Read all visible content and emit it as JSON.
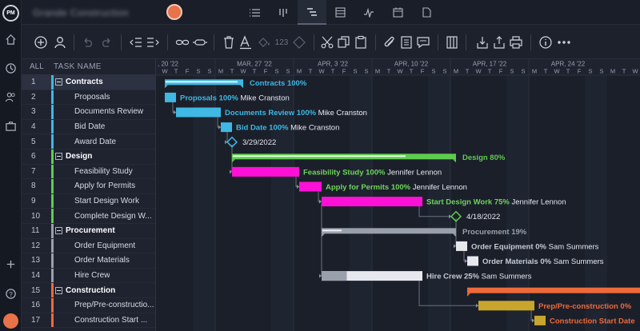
{
  "app": {
    "logo": "PM",
    "project_title": "Grande Construction"
  },
  "rail_icons": [
    "home-icon",
    "clock-icon",
    "people-icon",
    "briefcase-icon",
    "plus-icon",
    "help-icon"
  ],
  "view_tabs": [
    "list-view-icon",
    "board-view-icon",
    "gantt-view-icon",
    "sheet-view-icon",
    "dashboard-view-icon",
    "calendar-view-icon",
    "files-view-icon"
  ],
  "toolbar": {
    "number_format_label": "123"
  },
  "grid": {
    "col_all": "ALL",
    "col_task_name": "TASK NAME",
    "rows": [
      {
        "num": "1",
        "name": "Contracts",
        "group": true,
        "selected": true,
        "color": "#3fb8e3"
      },
      {
        "num": "2",
        "name": "Proposals",
        "color": "#3fb8e3"
      },
      {
        "num": "3",
        "name": "Documents Review",
        "color": "#3fb8e3"
      },
      {
        "num": "4",
        "name": "Bid Date",
        "color": "#3fb8e3"
      },
      {
        "num": "5",
        "name": "Award Date",
        "color": "#3fb8e3"
      },
      {
        "num": "6",
        "name": "Design",
        "group": true,
        "color": "#5ecb4f"
      },
      {
        "num": "7",
        "name": "Feasibility Study",
        "color": "#5ecb4f"
      },
      {
        "num": "8",
        "name": "Apply for Permits",
        "color": "#5ecb4f"
      },
      {
        "num": "9",
        "name": "Start Design Work",
        "color": "#5ecb4f"
      },
      {
        "num": "10",
        "name": "Complete Design W...",
        "color": "#5ecb4f"
      },
      {
        "num": "11",
        "name": "Procurement",
        "group": true,
        "color": "#9aa0ab"
      },
      {
        "num": "12",
        "name": "Order Equipment",
        "color": "#9aa0ab"
      },
      {
        "num": "13",
        "name": "Order Materials",
        "color": "#9aa0ab"
      },
      {
        "num": "14",
        "name": "Hire Crew",
        "color": "#9aa0ab"
      },
      {
        "num": "15",
        "name": "Construction",
        "group": true,
        "color": "#ee6a3a"
      },
      {
        "num": "16",
        "name": "Prep/Pre-constructio...",
        "color": "#ee6a3a"
      },
      {
        "num": "17",
        "name": "Construction Start ...",
        "color": "#ee6a3a"
      }
    ]
  },
  "timeline": {
    "weeks": [
      ", 20 '22",
      "MAR, 27 '22",
      "APR, 3 '22",
      "APR, 10 '22",
      "APR, 17 '22",
      "APR, 24 '22"
    ],
    "day_letters": [
      "W",
      "T",
      "F",
      "S",
      "S",
      "M",
      "T",
      "W",
      "T",
      "F",
      "S",
      "S",
      "M",
      "T",
      "W",
      "T",
      "F",
      "S",
      "S",
      "M",
      "T",
      "W",
      "T",
      "F",
      "S",
      "S",
      "M",
      "T",
      "W",
      "T",
      "F",
      "S",
      "S",
      "M",
      "T",
      "W",
      "T",
      "F",
      "S",
      "S",
      "M",
      "T",
      "W"
    ]
  },
  "bars": [
    {
      "row": 0,
      "kind": "group",
      "start": 0.5,
      "end": 7.5,
      "progress": 1.0,
      "color": "#3fb8e3",
      "label": "Contracts",
      "percent": "100%",
      "assignee": ""
    },
    {
      "row": 1,
      "kind": "task",
      "start": 0.5,
      "end": 1.5,
      "progress": 1.0,
      "color": "#3fb8e3",
      "label": "Proposals",
      "percent": "100%",
      "assignee": "Mike Cranston"
    },
    {
      "row": 2,
      "kind": "task",
      "start": 1.5,
      "end": 5.5,
      "progress": 1.0,
      "color": "#3fb8e3",
      "label": "Documents Review",
      "percent": "100%",
      "assignee": "Mike Cranston"
    },
    {
      "row": 3,
      "kind": "task",
      "start": 5.5,
      "end": 6.5,
      "progress": 1.0,
      "color": "#3fb8e3",
      "label": "Bid Date",
      "percent": "100%",
      "assignee": "Mike Cranston"
    },
    {
      "row": 4,
      "kind": "milestone",
      "start": 6.5,
      "color": "#3fb8e3",
      "date": "3/29/2022"
    },
    {
      "row": 5,
      "kind": "group",
      "start": 6.5,
      "end": 26.5,
      "progress": 0.8,
      "color": "#5ecb4f",
      "label": "Design",
      "percent": "80%",
      "assignee": ""
    },
    {
      "row": 6,
      "kind": "task",
      "start": 6.5,
      "end": 12.5,
      "progress": 1.0,
      "color": "#ff10d6",
      "label": "Feasibility Study",
      "percent": "100%",
      "assignee": "Jennifer Lennon",
      "label_color": "#6fd55c"
    },
    {
      "row": 7,
      "kind": "task",
      "start": 12.5,
      "end": 14.5,
      "progress": 1.0,
      "color": "#ff10d6",
      "label": "Apply for Permits",
      "percent": "100%",
      "assignee": "Jennifer Lennon",
      "label_color": "#6fd55c"
    },
    {
      "row": 8,
      "kind": "task",
      "start": 14.5,
      "end": 23.5,
      "progress": 0.75,
      "color": "#ff10d6",
      "label": "Start Design Work",
      "percent": "75%",
      "assignee": "Jennifer Lennon",
      "label_color": "#6fd55c"
    },
    {
      "row": 9,
      "kind": "milestone",
      "start": 26.5,
      "color": "#5ecb4f",
      "date": "4/18/2022"
    },
    {
      "row": 10,
      "kind": "group",
      "start": 14.5,
      "end": 26.5,
      "progress": 0.19,
      "color": "#9aa0ab",
      "label": "Procurement",
      "percent": "19%",
      "assignee": ""
    },
    {
      "row": 11,
      "kind": "task",
      "start": 26.5,
      "end": 27.5,
      "progress": 0.0,
      "color": "#e6e8ee",
      "label": "Order Equipment",
      "percent": "0%",
      "assignee": "Sam Summers",
      "label_color": "#c7cbd4"
    },
    {
      "row": 12,
      "kind": "task",
      "start": 27.5,
      "end": 28.5,
      "progress": 0.0,
      "color": "#e6e8ee",
      "label": "Order Materials",
      "percent": "0%",
      "assignee": "Sam Summers",
      "label_color": "#c7cbd4"
    },
    {
      "row": 13,
      "kind": "task",
      "start": 14.5,
      "end": 23.5,
      "progress": 0.25,
      "color": "#9aa0ab",
      "rest": "#e6e8ee",
      "label": "Hire Crew",
      "percent": "25%",
      "assignee": "Sam Summers",
      "label_color": "#c7cbd4"
    },
    {
      "row": 14,
      "kind": "group",
      "start": 27.5,
      "end": 43.5,
      "progress": 0.0,
      "color": "#ee6a3a",
      "label": "",
      "percent": "",
      "assignee": ""
    },
    {
      "row": 15,
      "kind": "task",
      "start": 28.5,
      "end": 33.5,
      "progress": 1.0,
      "color": "#c8a62e",
      "label": "Prep/Pre-construction",
      "percent": "0%",
      "assignee": "",
      "label_color": "#ee6a3a"
    },
    {
      "row": 16,
      "kind": "task",
      "start": 33.5,
      "end": 34.5,
      "progress": 1.0,
      "color": "#c8a62e",
      "label": "Construction Start Date",
      "percent": "",
      "assignee": "",
      "label_color": "#ee6a3a"
    }
  ],
  "links": [
    [
      1,
      2
    ],
    [
      2,
      3
    ],
    [
      3,
      4
    ],
    [
      4,
      6
    ],
    [
      6,
      7
    ],
    [
      7,
      8
    ],
    [
      8,
      9
    ],
    [
      9,
      11
    ],
    [
      11,
      12
    ],
    [
      8,
      13
    ],
    [
      13,
      15
    ],
    [
      15,
      16
    ]
  ]
}
